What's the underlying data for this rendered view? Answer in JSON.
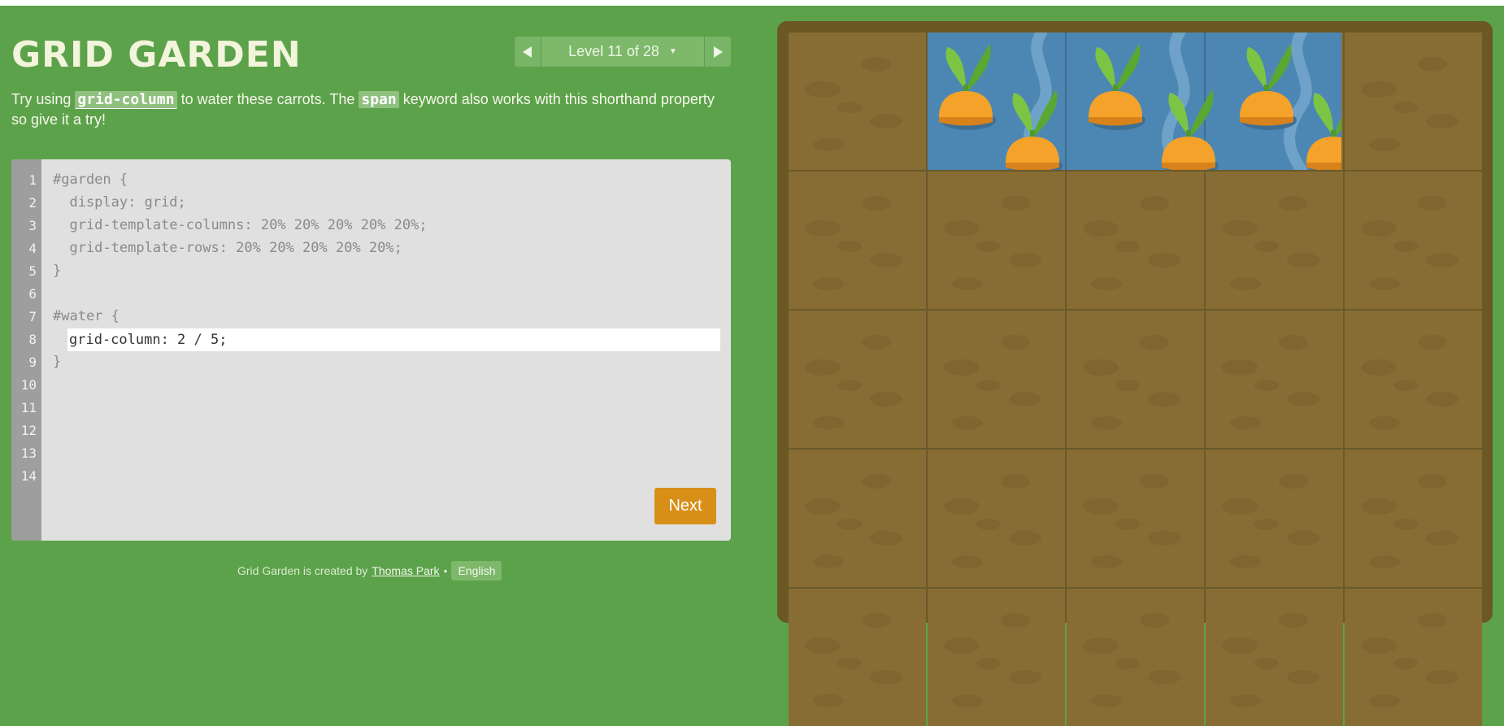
{
  "header": {
    "title": "GRID GARDEN",
    "level_label": "Level 11 of 28"
  },
  "instructions": {
    "prefix": "Try using ",
    "code1": "grid-column",
    "middle": " to water these carrots. The ",
    "code2": "span",
    "suffix": " keyword also works with this shorthand property so give it a try!"
  },
  "editor": {
    "line_numbers": [
      "1",
      "2",
      "3",
      "4",
      "5",
      "6",
      "7",
      "8",
      "9",
      "10",
      "11",
      "12",
      "13",
      "14"
    ],
    "lines": [
      "#garden {",
      "  display: grid;",
      "  grid-template-columns: 20% 20% 20% 20% 20%;",
      "  grid-template-rows: 20% 20% 20% 20% 20%;",
      "}",
      "",
      "#water {",
      "",
      "}"
    ],
    "input_value": "grid-column: 2 / 5;",
    "next_label": "Next"
  },
  "footer": {
    "text": "Grid Garden is created by",
    "author": "Thomas Park",
    "separator": "•",
    "language": "English"
  },
  "garden": {
    "columns": 5,
    "rows": 5,
    "water_columns": "2 / 5",
    "carrot_count": 6
  },
  "colors": {
    "background": "#5ca24a",
    "soil": "#876d34",
    "water": "#4c87b3",
    "next_button": "#d88f18",
    "editor": "#e0e0e0"
  }
}
